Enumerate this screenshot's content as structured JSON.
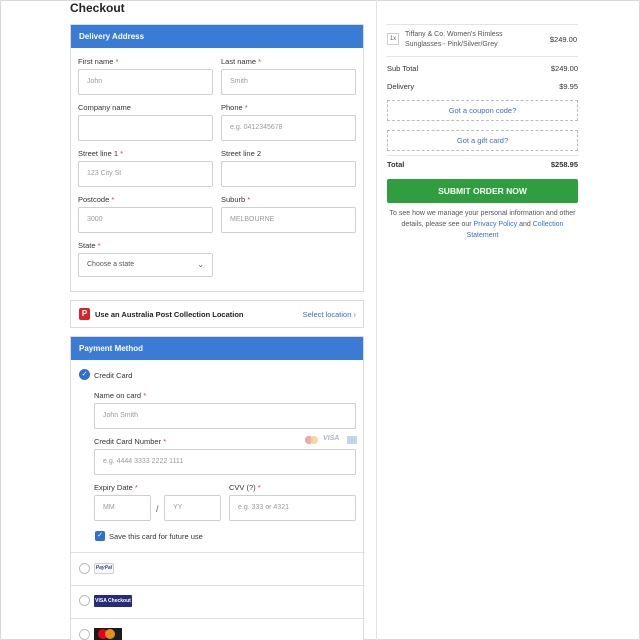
{
  "page": {
    "title": "Checkout"
  },
  "delivery": {
    "heading": "Delivery Address",
    "first_name": {
      "label": "First name",
      "placeholder": "John"
    },
    "last_name": {
      "label": "Last name",
      "placeholder": "Smith"
    },
    "company": {
      "label": "Company name",
      "placeholder": ""
    },
    "phone": {
      "label": "Phone",
      "placeholder": "e.g. 0412345678"
    },
    "street1": {
      "label": "Street line 1",
      "placeholder": "123 City St"
    },
    "street2": {
      "label": "Street line 2",
      "placeholder": ""
    },
    "postcode": {
      "label": "Postcode",
      "placeholder": "3000"
    },
    "suburb": {
      "label": "Suburb",
      "placeholder": "MELBOURNE"
    },
    "state": {
      "label": "State",
      "value": "Choose a state"
    },
    "required_mark": "*"
  },
  "auspost": {
    "text": "Use an Australia Post Collection Location",
    "link": "Select location",
    "icon": "australia-post-icon",
    "brand_color": "#d8232a"
  },
  "payment": {
    "heading": "Payment Method",
    "credit_card_label": "Credit Card",
    "name_on_card": {
      "label": "Name on card",
      "placeholder": "John Smith"
    },
    "card_number": {
      "label": "Credit Card Number",
      "placeholder": "e.g. 4444 3333 2222 1111"
    },
    "card_brands": [
      "MasterCard",
      "VISA",
      "AMEX"
    ],
    "expiry": {
      "label": "Expiry Date",
      "mm": "MM",
      "yy": "YY",
      "sep": "/"
    },
    "cvv": {
      "label": "CVV (?)",
      "placeholder": "e.g. 333 or 4321"
    },
    "save_card": "Save this card for future use",
    "options": [
      "PayPal",
      "VISA Checkout",
      "MasterCard"
    ]
  },
  "summary": {
    "item": {
      "qty": "1x",
      "name": "Tiffany & Co. Women's Rimless Sunglasses - Pink/Silver/Grey",
      "price": "$249.00"
    },
    "subtotal": {
      "label": "Sub Total",
      "value": "$249.00"
    },
    "delivery": {
      "label": "Delivery",
      "value": "$9.95"
    },
    "coupon": "Got a coupon code?",
    "gift": "Got a gift card?",
    "total": {
      "label": "Total",
      "value": "$258.95"
    },
    "submit": "SUBMIT ORDER NOW",
    "info_prefix": "To see how we manage your personal information and other details, please see our",
    "privacy": "Privacy Policy",
    "and": "and",
    "collection": "Collection Statement"
  },
  "colors": {
    "accent": "#3a7bd5",
    "submit": "#2e9e3e",
    "link": "#3a6fc4"
  }
}
